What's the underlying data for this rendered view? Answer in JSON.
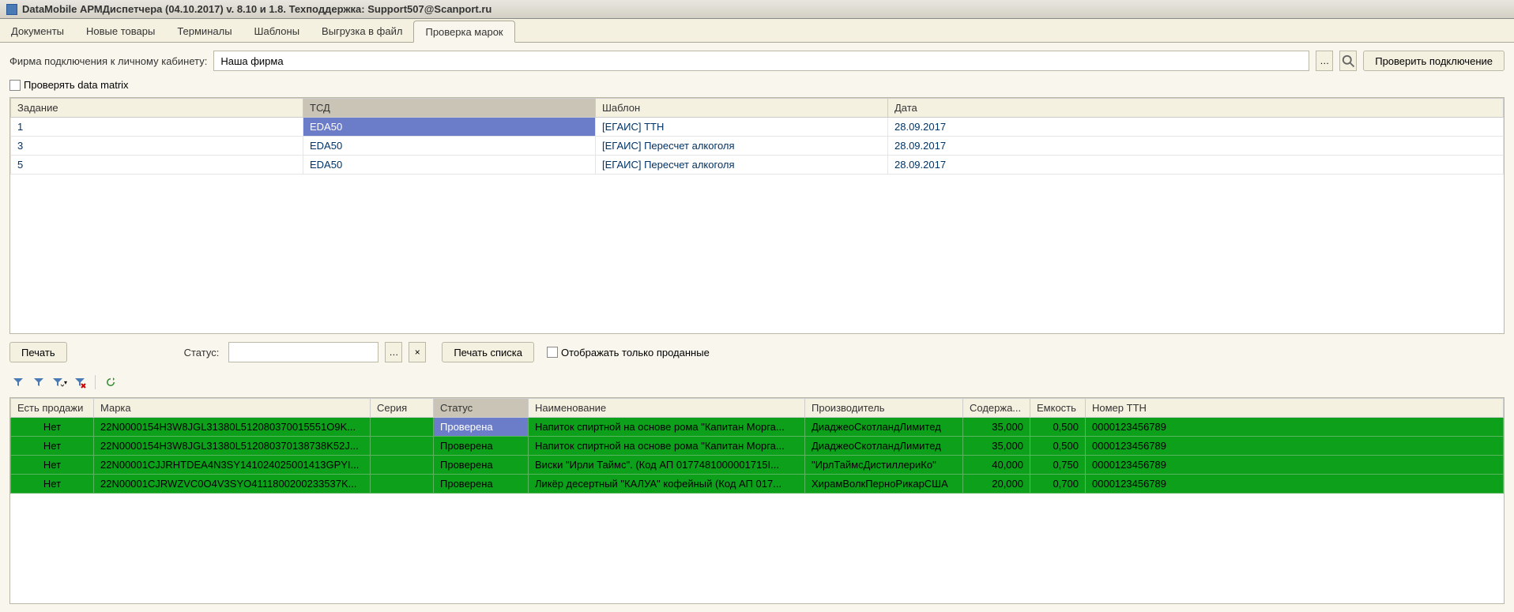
{
  "titlebar": "DataMobile АРМДиспетчера (04.10.2017) v. 8.10 и 1.8. Техподдержка: Support507@Scanport.ru",
  "tabs": [
    "Документы",
    "Новые товары",
    "Терминалы",
    "Шаблоны",
    "Выгрузка в файл",
    "Проверка марок"
  ],
  "active_tab": 5,
  "firm_label": "Фирма подключения к личному кабинету:",
  "firm_value": "Наша фирма",
  "check_conn_btn": "Проверить подключение",
  "check_dm_label": "Проверять data matrix",
  "top_table": {
    "headers": [
      "Задание",
      "ТСД",
      "Шаблон",
      "Дата"
    ],
    "rows": [
      {
        "task": "1",
        "tsd": "EDA50",
        "template": "[ЕГАИС] ТТН",
        "date": "28.09.2017",
        "selected": true
      },
      {
        "task": "3",
        "tsd": "EDA50",
        "template": "[ЕГАИС] Пересчет алкоголя",
        "date": "28.09.2017",
        "selected": false
      },
      {
        "task": "5",
        "tsd": "EDA50",
        "template": "[ЕГАИС] Пересчет алкоголя",
        "date": "28.09.2017",
        "selected": false
      }
    ]
  },
  "print_btn": "Печать",
  "status_label": "Статус:",
  "print_list_btn": "Печать списка",
  "show_sold_label": "Отображать только проданные",
  "bottom_table": {
    "headers": [
      "Есть продажи",
      "Марка",
      "Серия",
      "Статус",
      "Наименование",
      "Производитель",
      "Содержа...",
      "Емкость",
      "Номер ТТН"
    ],
    "rows": [
      {
        "sold": "Нет",
        "mark": "22N0000154H3W8JGL31380L512080370015551O9K...",
        "series": "",
        "status": "Проверена",
        "name": "Напиток спиртной на основе рома \"Капитан Морга...",
        "mfr": "ДиаджеоСкотландЛимитед",
        "cont": "35,000",
        "vol": "0,500",
        "ttn": "0000123456789",
        "sel": true
      },
      {
        "sold": "Нет",
        "mark": "22N0000154H3W8JGL31380L512080370138738K52J...",
        "series": "",
        "status": "Проверена",
        "name": "Напиток спиртной на основе рома \"Капитан Морга...",
        "mfr": "ДиаджеоСкотландЛимитед",
        "cont": "35,000",
        "vol": "0,500",
        "ttn": "0000123456789",
        "sel": false
      },
      {
        "sold": "Нет",
        "mark": "22N00001CJJRHTDEA4N3SY141024025001413GPYI...",
        "series": "",
        "status": "Проверена",
        "name": "Виски \"Ирли Таймс\". (Код АП 0177481000001715I...",
        "mfr": "\"ИрлТаймсДистиллериКо\"",
        "cont": "40,000",
        "vol": "0,750",
        "ttn": "0000123456789",
        "sel": false
      },
      {
        "sold": "Нет",
        "mark": "22N00001CJRWZVC0O4V3SYO4111800200233537K...",
        "series": "",
        "status": "Проверена",
        "name": "Ликёр десертный \"КАЛУА\" кофейный (Код АП 017...",
        "mfr": "ХирамВолкПерноРикарСША",
        "cont": "20,000",
        "vol": "0,700",
        "ttn": "0000123456789",
        "sel": false
      }
    ]
  }
}
